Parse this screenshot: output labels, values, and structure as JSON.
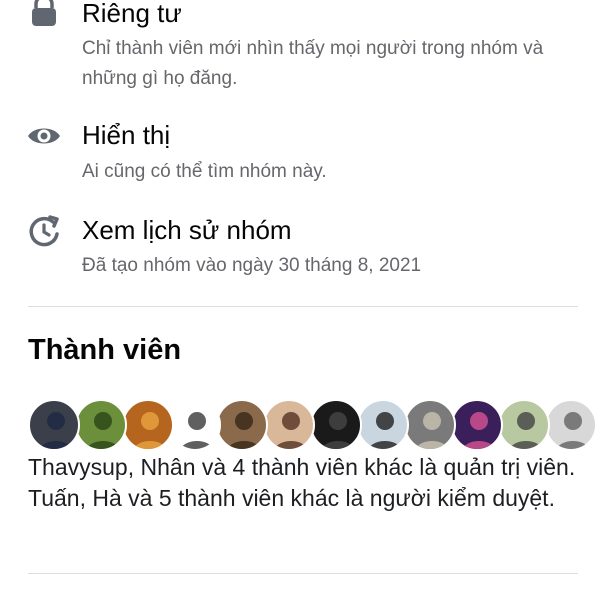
{
  "privacy": {
    "title": "Riêng tư",
    "desc": "Chỉ thành viên mới nhìn thấy mọi người trong nhóm và những gì họ đăng.",
    "icon": "lock-icon"
  },
  "visibility": {
    "title": "Hiển thị",
    "desc": "Ai cũng có thể tìm nhóm này.",
    "icon": "eye-icon"
  },
  "history": {
    "title": "Xem lịch sử nhóm",
    "desc": "Đã tạo nhóm vào ngày 30 tháng 8, 2021",
    "icon": "history-icon"
  },
  "members": {
    "title": "Thành viên",
    "summary": "Thavysup, Nhân và 4 thành viên khác là quản trị viên. Tuấn, Hà và 5 thành viên khác là người kiểm duyệt.",
    "avatars": [
      {
        "name": "avatar-1",
        "bg": "#3a3f4a",
        "fg": "#1f2a44"
      },
      {
        "name": "avatar-2",
        "bg": "#6b8f3a",
        "fg": "#2e4a1a"
      },
      {
        "name": "avatar-3",
        "bg": "#b5651d",
        "fg": "#e8a040"
      },
      {
        "name": "avatar-4",
        "bg": "#ffffff",
        "fg": "#444444"
      },
      {
        "name": "avatar-5",
        "bg": "#8a6a4a",
        "fg": "#3b2a1a"
      },
      {
        "name": "avatar-6",
        "bg": "#d9b89a",
        "fg": "#5a3a2a"
      },
      {
        "name": "avatar-7",
        "bg": "#1a1a1a",
        "fg": "#444444"
      },
      {
        "name": "avatar-8",
        "bg": "#c9d6e0",
        "fg": "#2a2a2a"
      },
      {
        "name": "avatar-9",
        "bg": "#7a7a7a",
        "fg": "#c7c0b0"
      },
      {
        "name": "avatar-10",
        "bg": "#3a1f5a",
        "fg": "#d05090"
      },
      {
        "name": "avatar-11",
        "bg": "#b8c8a0",
        "fg": "#4a4a4a"
      },
      {
        "name": "avatar-12",
        "bg": "#d8d8d8",
        "fg": "#6a6a6a"
      }
    ]
  }
}
